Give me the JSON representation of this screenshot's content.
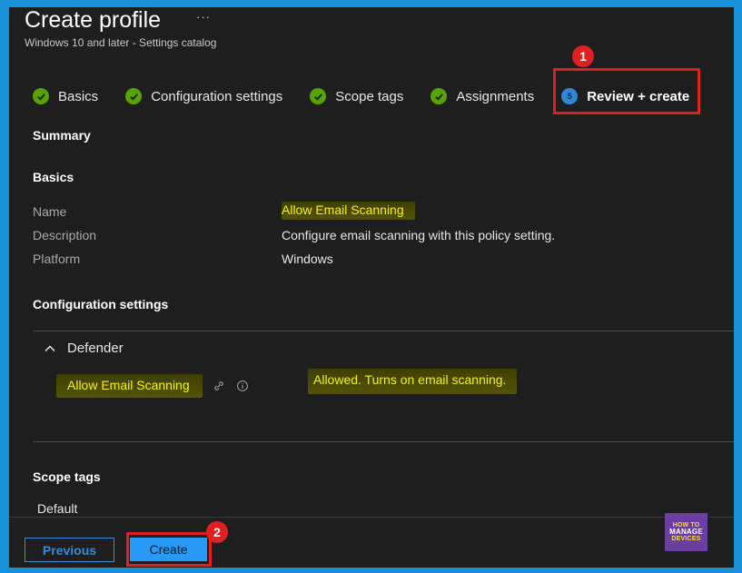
{
  "header": {
    "title": "Create profile",
    "more": "···",
    "subtitle": "Windows 10 and later - Settings catalog"
  },
  "steps": [
    {
      "label": "Basics",
      "state": "completed"
    },
    {
      "label": "Configuration settings",
      "state": "completed"
    },
    {
      "label": "Scope tags",
      "state": "completed"
    },
    {
      "label": "Assignments",
      "state": "completed"
    },
    {
      "label": "Review + create",
      "state": "current",
      "number": "5"
    }
  ],
  "summary": {
    "heading": "Summary",
    "basics": {
      "heading": "Basics",
      "name_label": "Name",
      "name_value": "Allow Email Scanning",
      "description_label": "Description",
      "description_value": "Configure email scanning with this policy setting.",
      "platform_label": "Platform",
      "platform_value": "Windows"
    },
    "configuration": {
      "heading": "Configuration settings",
      "group": "Defender",
      "setting_name": "Allow Email Scanning",
      "setting_value": "Allowed. Turns on email scanning."
    },
    "scope_tags": {
      "heading": "Scope tags",
      "value": "Default"
    }
  },
  "footer": {
    "previous_label": "Previous",
    "create_label": "Create"
  },
  "callouts": {
    "one": "1",
    "two": "2"
  },
  "logo": {
    "line1": "HOW TO",
    "line2": "MANAGE",
    "line3": "DEVICES"
  },
  "colors": {
    "background": "#1e1e1e",
    "accent": "#2899f5",
    "success": "#57a300",
    "highlight_text": "#f5f500",
    "callout": "#e02020"
  }
}
